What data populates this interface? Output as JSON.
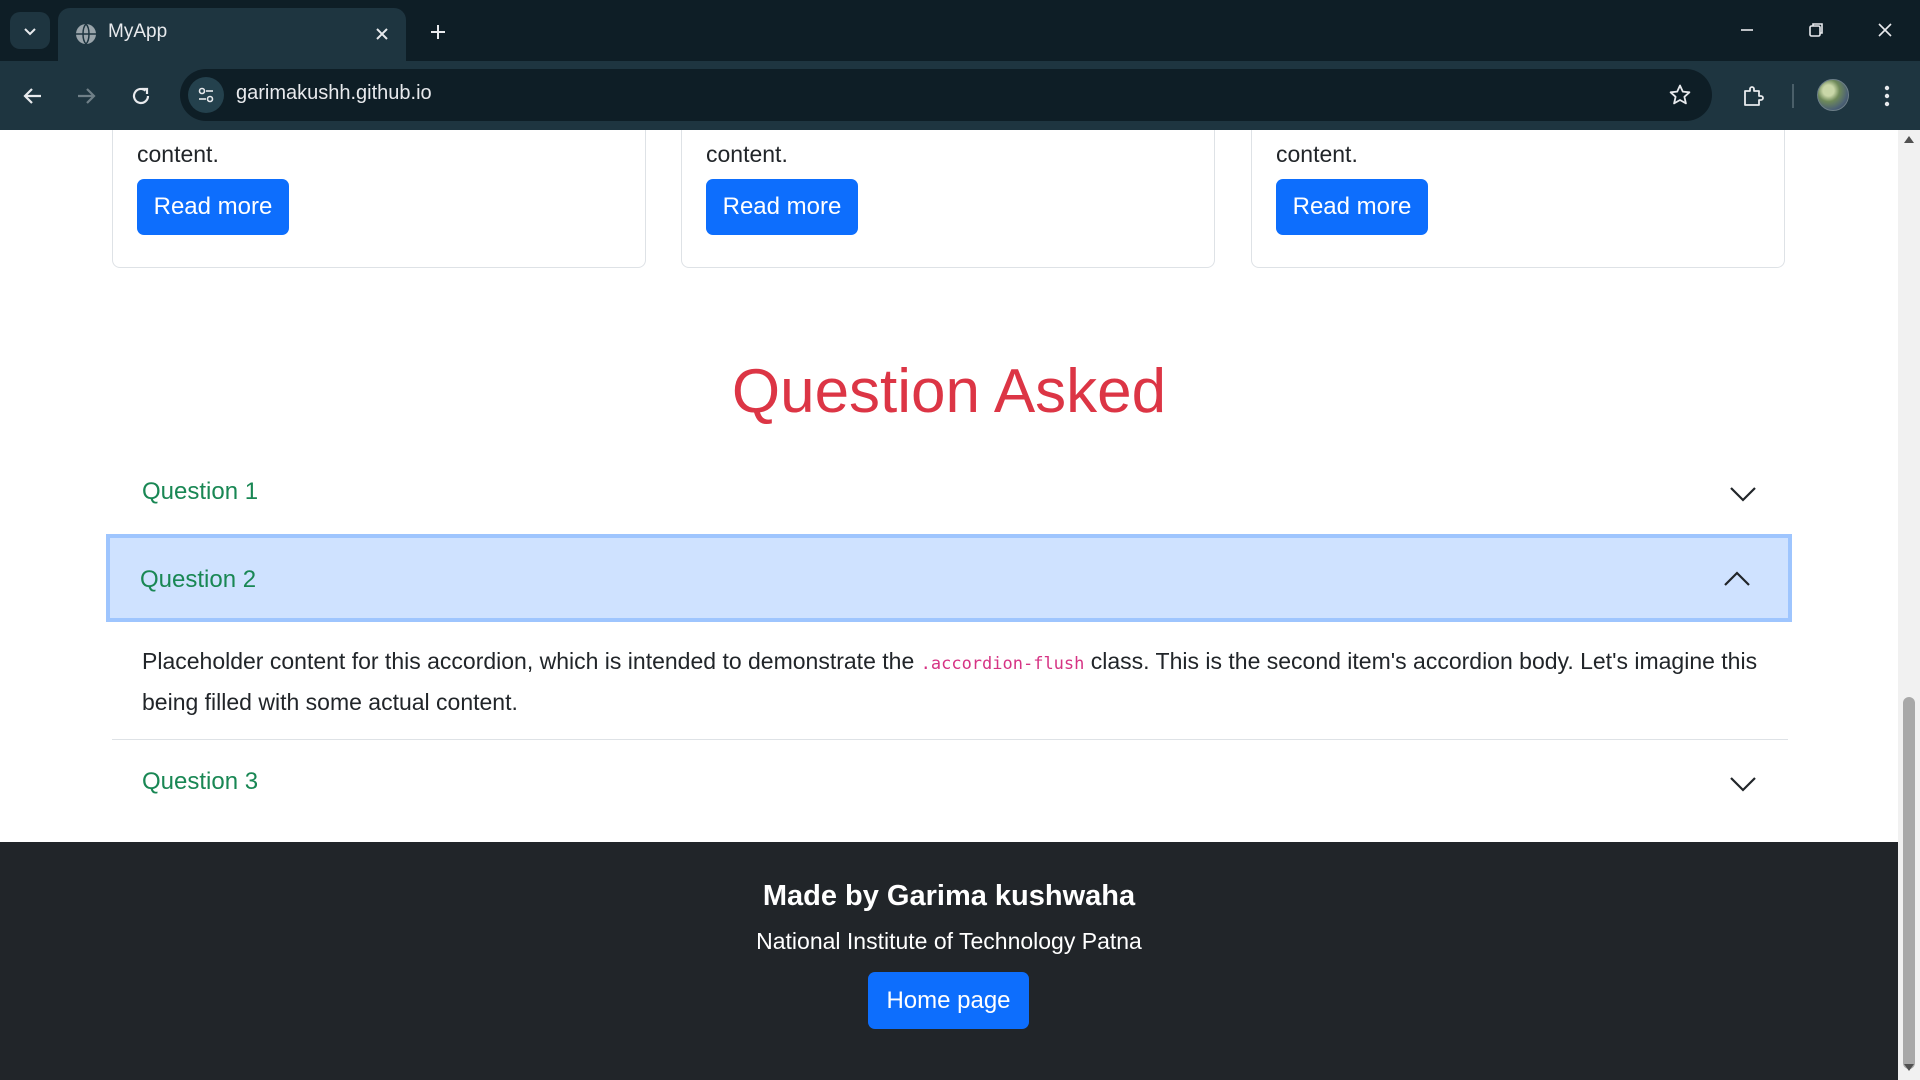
{
  "browser": {
    "tab_title": "MyApp",
    "url": "garimakushh.github.io"
  },
  "cards": [
    {
      "text": "content.",
      "button_label": "Read more"
    },
    {
      "text": "content.",
      "button_label": "Read more"
    },
    {
      "text": "content.",
      "button_label": "Read more"
    }
  ],
  "faq": {
    "heading": "Question Asked",
    "items": [
      {
        "title": "Question 1",
        "expanded": false
      },
      {
        "title": "Question 2",
        "expanded": true,
        "body_before": "Placeholder content for this accordion, which is intended to demonstrate the ",
        "body_code": ".accordion-flush",
        "body_after": " class. This is the second item's accordion body. Let's imagine this being filled with some actual content."
      },
      {
        "title": "Question 3",
        "expanded": false
      }
    ]
  },
  "footer": {
    "title": "Made by Garima kushwaha",
    "subtitle": "National Institute of Technology Patna",
    "button_label": "Home page"
  },
  "colors": {
    "primary": "#0d6efd",
    "heading_red": "#dc3545",
    "accordion_title_green": "#198754",
    "accordion_active_bg": "#cfe2ff",
    "footer_bg": "#212529"
  },
  "icons": [
    "tab-list-icon",
    "globe-icon",
    "close-icon",
    "plus-icon",
    "minimize-icon",
    "restore-icon",
    "back-arrow-icon",
    "forward-arrow-icon",
    "reload-icon",
    "site-settings-icon",
    "star-icon",
    "extensions-icon",
    "kebab-menu-icon",
    "chevron-down-icon",
    "chevron-up-icon"
  ]
}
